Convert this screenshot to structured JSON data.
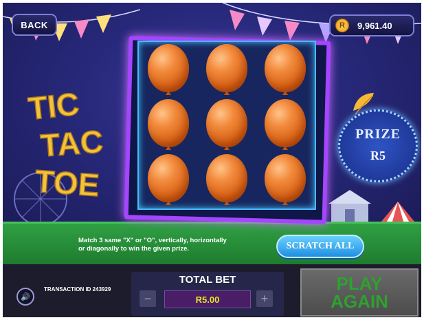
{
  "topbar": {
    "back_label": "BACK",
    "currency_symbol": "R",
    "balance": "9,961.40"
  },
  "game": {
    "title_lines": [
      "TIC",
      "TAC",
      "TOE"
    ],
    "grid": {
      "rows": 3,
      "cols": 3,
      "cells": [
        {
          "cover": "orange-balloon"
        },
        {
          "cover": "orange-balloon"
        },
        {
          "cover": "orange-balloon"
        },
        {
          "cover": "orange-balloon"
        },
        {
          "cover": "orange-balloon"
        },
        {
          "cover": "orange-balloon"
        },
        {
          "cover": "orange-balloon"
        },
        {
          "cover": "orange-balloon"
        },
        {
          "cover": "orange-balloon"
        }
      ]
    },
    "prize": {
      "label": "PRIZE",
      "value": "R5"
    },
    "instructions_line1": "Match 3 same \"X\" or \"O\", vertically, horizontally",
    "instructions_line2": "or diagonally to win the given prize.",
    "scratch_all_label": "SCRATCH ALL"
  },
  "footer": {
    "sound_icon": "speaker-icon",
    "transaction_id": "TRANSACTION ID 243929",
    "total_bet_label": "TOTAL BET",
    "total_bet_value": "R5.00",
    "minus_label": "−",
    "plus_label": "+",
    "play_again_line1": "PLAY",
    "play_again_line2": "AGAIN"
  },
  "colors": {
    "balloon": "#f28a3c",
    "board_border": "#a445ff",
    "bet_value_text": "#e6e52a",
    "play_again_text": "#2ea12e",
    "title_gold": "#f2c23a"
  }
}
